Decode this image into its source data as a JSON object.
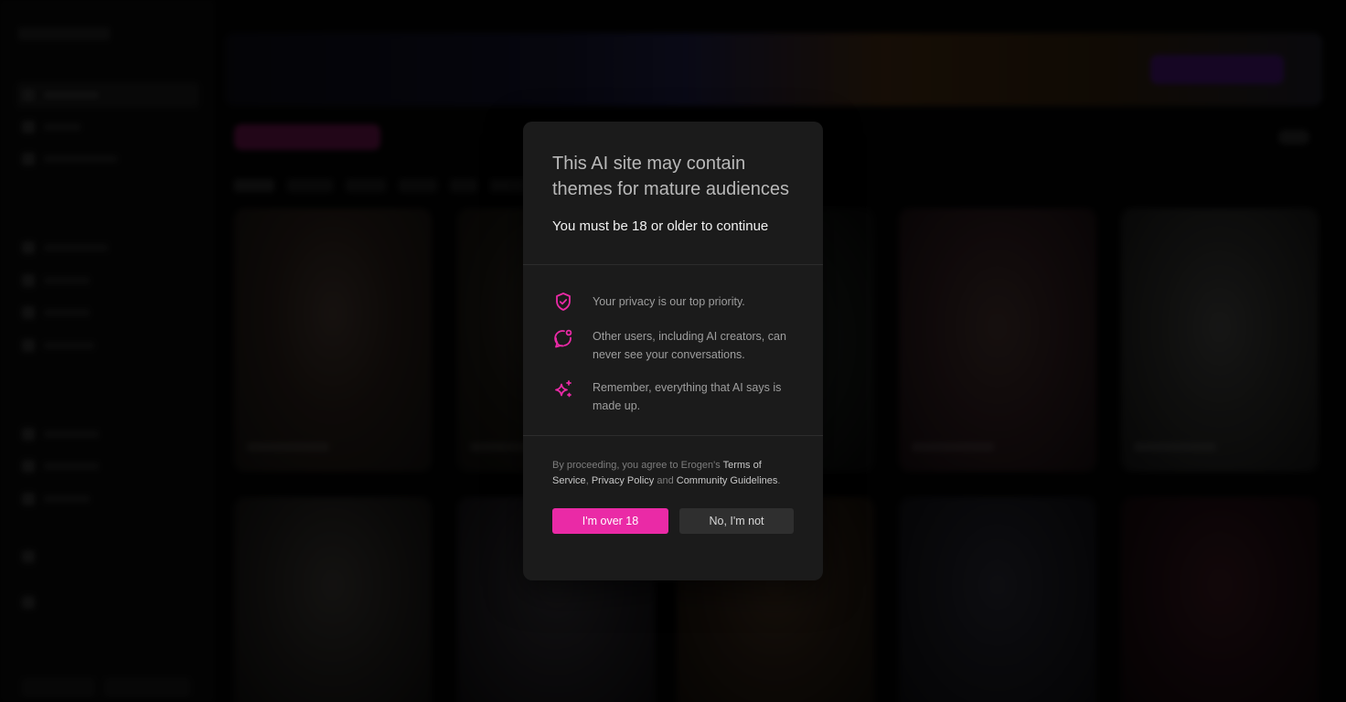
{
  "modal": {
    "title": "This AI site may contain themes for mature audiences",
    "subtitle": "You must be 18 or older to continue",
    "items": [
      {
        "icon": "shield-check-icon",
        "text": "Your privacy is our top priority."
      },
      {
        "icon": "chat-bubble-dot-icon",
        "text": "Other users, including AI creators, can never see your conversations."
      },
      {
        "icon": "sparkles-icon",
        "text": "Remember, everything that AI says is made up."
      }
    ],
    "legal": {
      "prefix": "By proceeding, you agree to Erogen's ",
      "terms": "Terms of Service",
      "sep1": ", ",
      "privacy": "Privacy Policy",
      "sep2": " and ",
      "community": "Community Guidelines",
      "suffix": "."
    },
    "confirm_label": "I'm over 18",
    "decline_label": "No, I'm not"
  },
  "colors": {
    "accent": "#ea2aa6",
    "modal_bg": "#1b1b1b",
    "secondary_button": "#2f2f2f"
  }
}
